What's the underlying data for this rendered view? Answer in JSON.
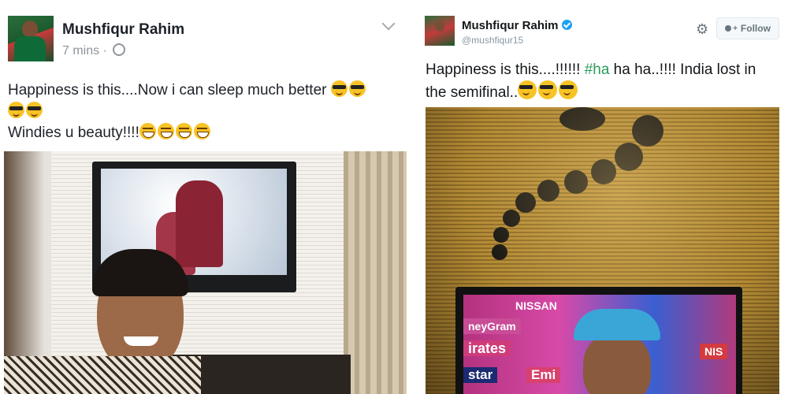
{
  "facebook_post": {
    "author_name": "Mushfiqur Rahim",
    "time": "7 mins",
    "separator": "·",
    "line1": "Happiness is this....Now i can sleep much better",
    "line2": "Windies u beauty!!!!",
    "line1_emojis": [
      "sunglasses",
      "sunglasses",
      "sunglasses",
      "sunglasses"
    ],
    "line2_emojis": [
      "laughing",
      "laughing",
      "laughing",
      "laughing"
    ],
    "icons": {
      "privacy": "globe-icon",
      "menu": "chevron-down-icon"
    }
  },
  "twitter_post": {
    "author_name": "Mushfiqur Rahim",
    "handle": "@mushfiqur15",
    "follow_label": "Follow",
    "text_before_hashtag": "Happiness is this....!!!!!! ",
    "hashtag": "#ha",
    "text_after_hashtag": " ha ha..!!!! India lost in the semifinal..",
    "emojis": [
      "sunglasses",
      "sunglasses",
      "sunglasses"
    ],
    "icons": {
      "settings": "gear-icon",
      "verified": "verified-badge-icon",
      "follow": "add-user-icon"
    },
    "tv_logos": [
      "NISSAN",
      "neyGram",
      "irates",
      "star",
      "Emi",
      "NIS"
    ]
  },
  "colors": {
    "facebook_text": "#1d2129",
    "facebook_meta": "#90949c",
    "twitter_text": "#14171a",
    "twitter_handle": "#8899a6",
    "hashtag": "#2a9d5c",
    "verified": "#1da1f2"
  }
}
